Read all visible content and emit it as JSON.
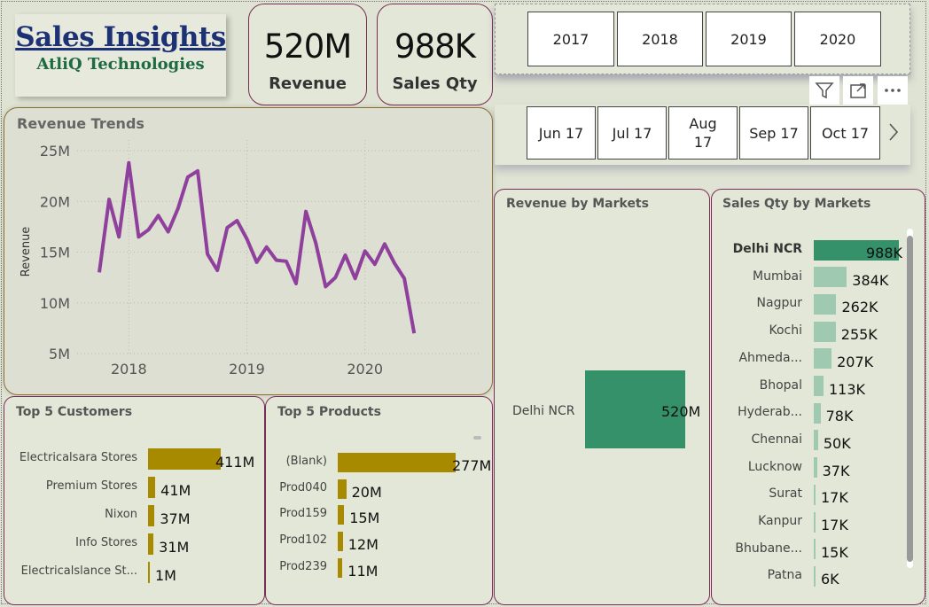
{
  "header": {
    "title": "Sales Insights",
    "subtitle": "AtliQ Technologies"
  },
  "kpis": {
    "revenue": {
      "value": "520M",
      "label": "Revenue"
    },
    "sales_qty": {
      "value": "988K",
      "label": "Sales Qty"
    }
  },
  "year_slicer": [
    "2017",
    "2018",
    "2019",
    "2020"
  ],
  "month_slicer": [
    "Jun 17",
    "Jul 17",
    "Aug 17",
    "Sep 17",
    "Oct 17"
  ],
  "toolbar": {
    "filter_icon": "filter-icon",
    "focus_icon": "focus-mode-icon",
    "more_icon": "more-options-icon"
  },
  "revenue_trends": {
    "title": "Revenue Trends",
    "ylabel": "Revenue",
    "y_ticks": [
      "25M",
      "20M",
      "15M",
      "10M",
      "5M"
    ],
    "x_ticks": [
      "2018",
      "2019",
      "2020"
    ]
  },
  "revenue_by_markets": {
    "title": "Revenue by Markets",
    "category": "Delhi NCR",
    "value_label": "520M"
  },
  "sales_qty_by_markets": {
    "title": "Sales Qty by Markets"
  },
  "top_customers": {
    "title": "Top 5 Customers"
  },
  "top_products": {
    "title": "Top 5 Products"
  },
  "colors": {
    "line": "#8f3f9c",
    "market_bar": "#35916a",
    "market_bar_light": "#9fc9b0",
    "gold_bar": "#a88a00",
    "border": "#7a2b5a"
  },
  "chart_data": [
    {
      "type": "line",
      "title": "Revenue Trends",
      "ylabel": "Revenue",
      "ylim": [
        5000000,
        25000000
      ],
      "x": [
        "2017-10",
        "2017-11",
        "2017-12",
        "2018-01",
        "2018-02",
        "2018-03",
        "2018-04",
        "2018-05",
        "2018-06",
        "2018-07",
        "2018-08",
        "2018-09",
        "2018-10",
        "2018-11",
        "2018-12",
        "2019-01",
        "2019-02",
        "2019-03",
        "2019-04",
        "2019-05",
        "2019-06",
        "2019-07",
        "2019-08",
        "2019-09",
        "2019-10",
        "2019-11",
        "2019-12",
        "2020-01",
        "2020-02",
        "2020-03",
        "2020-04",
        "2020-05",
        "2020-06"
      ],
      "values": [
        13.0,
        20.2,
        16.5,
        23.8,
        16.5,
        17.2,
        18.6,
        17.0,
        19.3,
        22.4,
        23.0,
        14.8,
        13.2,
        17.4,
        18.1,
        16.3,
        14.0,
        15.5,
        14.2,
        14.1,
        11.9,
        19.0,
        15.9,
        11.6,
        12.5,
        14.7,
        12.4,
        15.1,
        13.8,
        15.8,
        13.9,
        12.4,
        7.0
      ],
      "value_unit": "M",
      "x_ticks": [
        "2018",
        "2019",
        "2020"
      ],
      "y_ticks": [
        "5M",
        "10M",
        "15M",
        "20M",
        "25M"
      ],
      "grid": true
    },
    {
      "type": "bar",
      "title": "Revenue by Markets",
      "categories": [
        "Delhi NCR"
      ],
      "values": [
        520
      ],
      "value_labels": [
        "520M"
      ]
    },
    {
      "type": "bar",
      "title": "Sales Qty by Markets",
      "categories": [
        "Delhi NCR",
        "Mumbai",
        "Nagpur",
        "Kochi",
        "Ahmeda...",
        "Bhopal",
        "Hyderab...",
        "Chennai",
        "Lucknow",
        "Surat",
        "Kanpur",
        "Bhubane...",
        "Patna"
      ],
      "values": [
        988,
        384,
        262,
        255,
        207,
        113,
        78,
        50,
        37,
        17,
        17,
        15,
        6
      ],
      "value_labels": [
        "988K",
        "384K",
        "262K",
        "255K",
        "207K",
        "113K",
        "78K",
        "50K",
        "37K",
        "17K",
        "17K",
        "15K",
        "6K"
      ]
    },
    {
      "type": "bar",
      "title": "Top 5 Customers",
      "categories": [
        "Electricalsara Stores",
        "Premium Stores",
        "Nixon",
        "Info Stores",
        "Electricalslance St..."
      ],
      "values": [
        411,
        41,
        37,
        31,
        1
      ],
      "value_labels": [
        "411M",
        "41M",
        "37M",
        "31M",
        "1M"
      ]
    },
    {
      "type": "bar",
      "title": "Top 5 Products",
      "categories": [
        "(Blank)",
        "Prod040",
        "Prod159",
        "Prod102",
        "Prod239"
      ],
      "values": [
        277,
        20,
        15,
        12,
        11
      ],
      "value_labels": [
        "277M",
        "20M",
        "15M",
        "12M",
        "11M"
      ]
    }
  ]
}
